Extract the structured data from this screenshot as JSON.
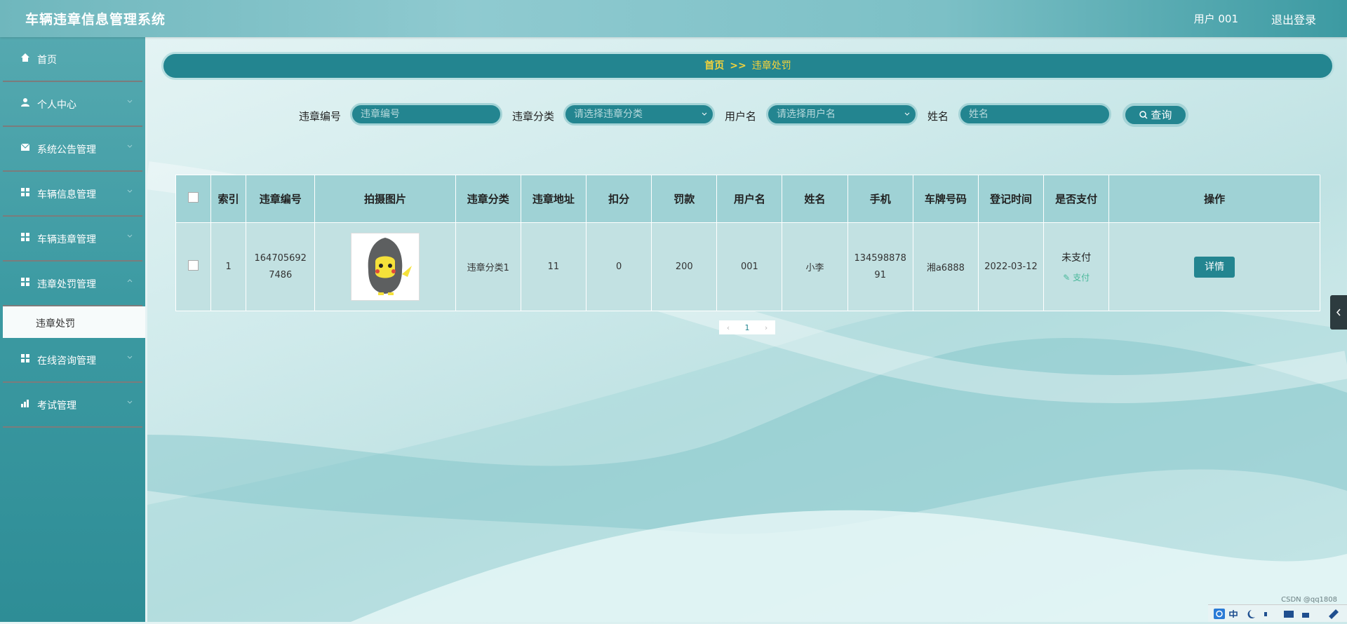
{
  "header": {
    "title": "车辆违章信息管理系统",
    "user": "用户 001",
    "logout": "退出登录"
  },
  "sidebar": {
    "items": [
      {
        "label": "首页",
        "icon": "home-icon"
      },
      {
        "label": "个人中心",
        "icon": "user-icon"
      },
      {
        "label": "系统公告管理",
        "icon": "mail-icon"
      },
      {
        "label": "车辆信息管理",
        "icon": "grid-icon"
      },
      {
        "label": "车辆违章管理",
        "icon": "grid-icon"
      },
      {
        "label": "违章处罚管理",
        "icon": "grid-icon"
      },
      {
        "label": "在线咨询管理",
        "icon": "grid-icon"
      },
      {
        "label": "考试管理",
        "icon": "chart-icon"
      }
    ],
    "active_sub": "违章处罚"
  },
  "breadcrumb": {
    "home": "首页",
    "separator": ">>",
    "current": "违章处罚"
  },
  "search": {
    "fields": [
      {
        "label": "违章编号",
        "placeholder": "违章编号"
      },
      {
        "label": "违章分类",
        "placeholder": "请选择违章分类"
      },
      {
        "label": "用户名",
        "placeholder": "请选择用户名"
      },
      {
        "label": "姓名",
        "placeholder": "姓名"
      }
    ],
    "button": "查询"
  },
  "table": {
    "headers": [
      "",
      "索引",
      "违章编号",
      "拍摄图片",
      "违章分类",
      "违章地址",
      "扣分",
      "罚款",
      "用户名",
      "姓名",
      "手机",
      "车牌号码",
      "登记时间",
      "是否支付",
      "操作"
    ],
    "rows": [
      {
        "index": "1",
        "code": "1647056927486",
        "category": "违章分类1",
        "address": "11",
        "points": "0",
        "fine": "200",
        "username": "001",
        "name": "小李",
        "phone": "13459887891",
        "plate": "湘a6888",
        "date": "2022-03-12",
        "pay_status": "未支付",
        "pay_action": "支付",
        "action": "详情"
      }
    ]
  },
  "pagination": {
    "current": "1"
  },
  "watermark": "CSDN @qq1808",
  "colors": {
    "primary": "#238590",
    "breadcrumb_text": "#f5d33a",
    "sidebar": "#3c9aa2"
  }
}
